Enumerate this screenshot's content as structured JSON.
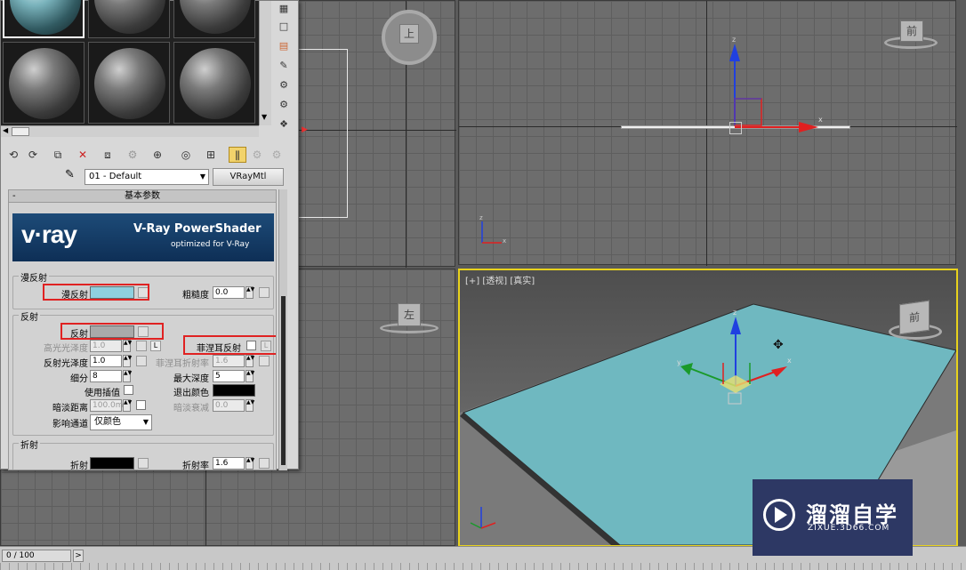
{
  "viewports": {
    "top_label": "",
    "front_label": "",
    "left_label": "",
    "persp_label": "[+] [透视] [真实]",
    "cube_top": "上",
    "cube_front": "前",
    "cube_left": "左",
    "cube_persp": "前"
  },
  "material_editor": {
    "material_name": "01 - Default",
    "material_type": "VRayMtl",
    "rollout_title": "基本参数",
    "banner_title": "V-Ray PowerShader",
    "banner_sub": "optimized for V-Ray",
    "banner_logo": "v·ray",
    "diffuse_group": "漫反射",
    "diffuse_label": "漫反射",
    "roughness_label": "粗糙度",
    "roughness_value": "0.0",
    "reflection_group": "反射",
    "reflect_label": "反射",
    "hilight_gloss_label": "高光光泽度",
    "hilight_gloss_value": "1.0",
    "hilight_lock": "L",
    "fresnel_label": "菲涅耳反射",
    "fresnel_lock": "L",
    "refl_gloss_label": "反射光泽度",
    "refl_gloss_value": "1.0",
    "fresnel_ior_label": "菲涅耳折射率",
    "fresnel_ior_value": "1.6",
    "subdivs_label": "细分",
    "subdivs_value": "8",
    "max_depth_label": "最大深度",
    "max_depth_value": "5",
    "use_interp_label": "使用插值",
    "exit_color_label": "退出颜色",
    "dim_dist_label": "暗淡距离",
    "dim_dist_value": "100.0m",
    "dim_falloff_label": "暗淡衰减",
    "dim_falloff_value": "0.0",
    "affect_channels_label": "影响通道",
    "affect_channels_value": "仅颜色",
    "refraction_group": "折射",
    "refract_label": "折射",
    "ior_label": "折射率",
    "ior_value": "1.6",
    "diffuse_color": "#8fd0df",
    "reflect_color": "#a9a9a9",
    "exit_color": "#000000",
    "refract_color": "#000000"
  },
  "status": {
    "frame": "0 / 100",
    "next": ">"
  },
  "watermark": {
    "title": "溜溜自学",
    "url": "ZIXUE.3D66.COM"
  },
  "colors": {
    "highlight": "#e02222",
    "active_viewport": "#e8d21c",
    "plane": "#6fb8c0"
  }
}
